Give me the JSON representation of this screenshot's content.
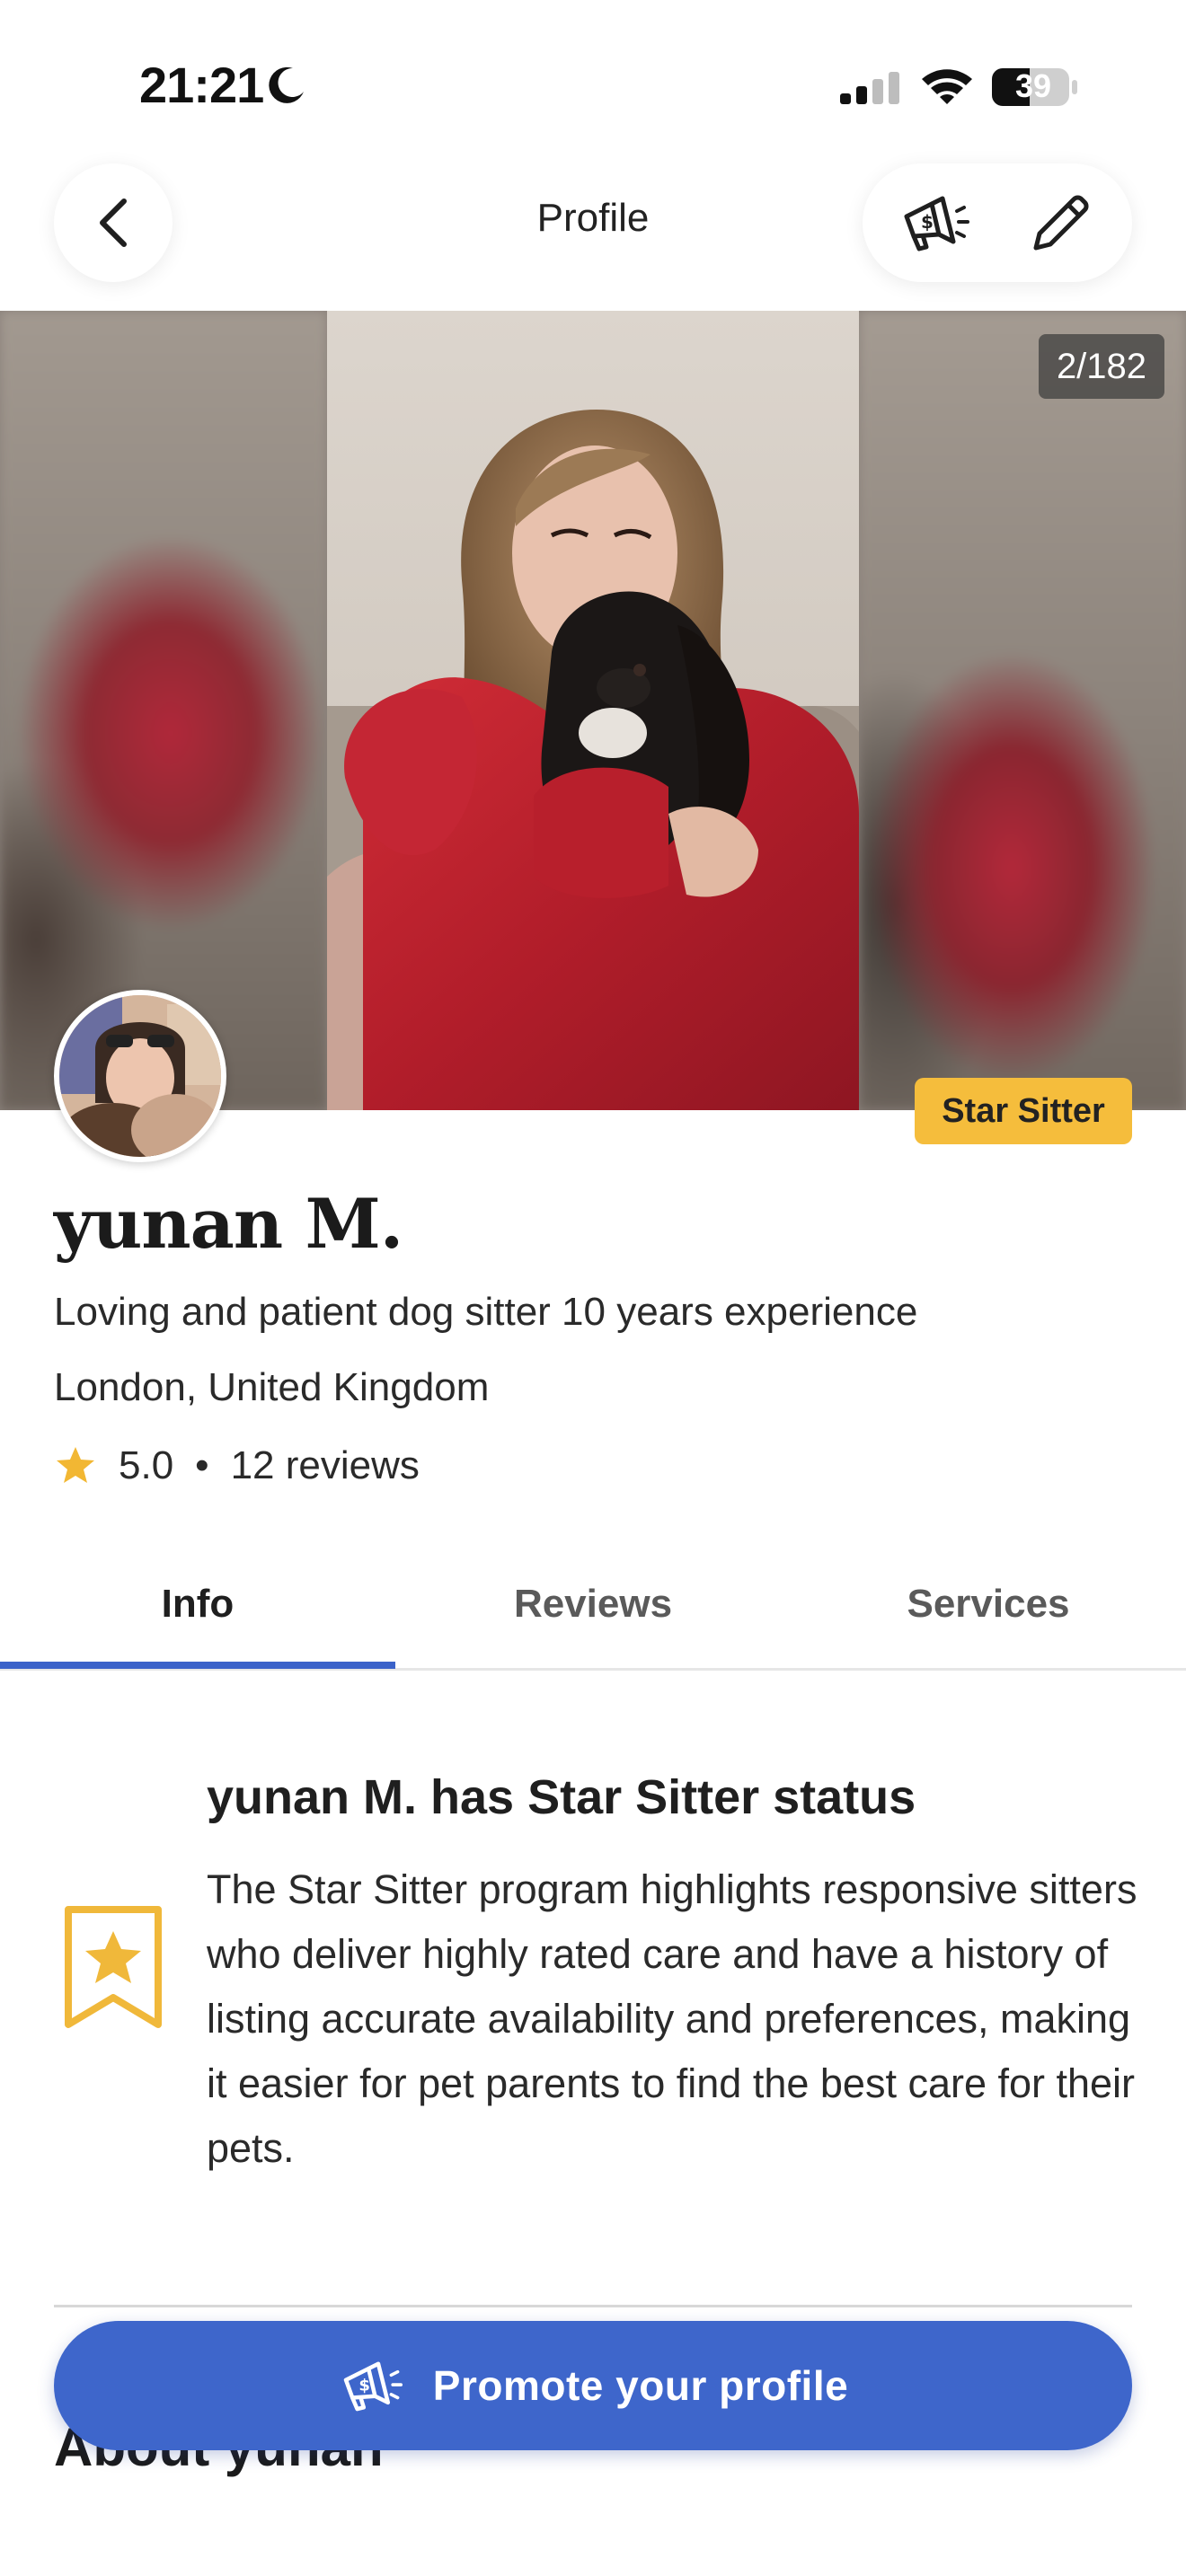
{
  "status_bar": {
    "time": "21:21",
    "battery_level": "39"
  },
  "header": {
    "title": "Profile"
  },
  "photo": {
    "counter": "2/182"
  },
  "profile": {
    "badge": "Star Sitter",
    "name": "yunan M.",
    "tagline": "Loving and patient dog sitter 10 years experience",
    "location": "London, United Kingdom",
    "rating": "5.0",
    "separator": "•",
    "reviews": "12 reviews"
  },
  "tabs": [
    {
      "label": "Info",
      "active": true
    },
    {
      "label": "Reviews",
      "active": false
    },
    {
      "label": "Services",
      "active": false
    }
  ],
  "star_sitter_section": {
    "title": "yunan M. has Star Sitter status",
    "body": "The Star Sitter program highlights responsive sitters who deliver highly rated care and have a history of listing accurate availability and preferences, making it easier for pet parents to find the best care for their pets."
  },
  "about": {
    "heading": "About yunan"
  },
  "promote_button": {
    "label": "Promote your profile"
  },
  "colors": {
    "accent_blue": "#3e66cb",
    "tab_indicator": "#3b62c9",
    "badge_yellow": "#f5bd3c",
    "star_yellow": "#f2b733"
  },
  "icons": {
    "back": "chevron-left-icon",
    "promote": "megaphone-dollar-icon",
    "edit": "pencil-icon",
    "rating": "star-icon",
    "star_sitter": "bookmark-star-icon"
  }
}
